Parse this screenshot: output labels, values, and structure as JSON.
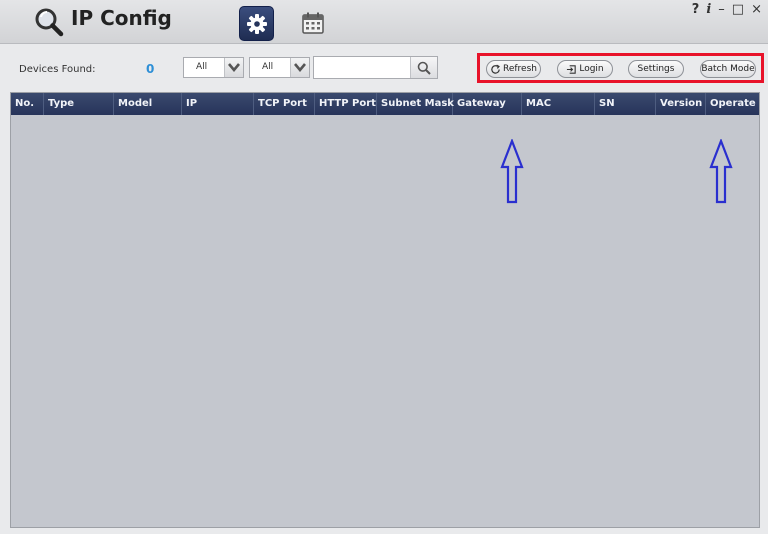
{
  "app": {
    "title": "IP Config"
  },
  "window_controls": {
    "help": "?",
    "info": "i",
    "minimize": "–",
    "maximize": "□",
    "close": "×"
  },
  "toolbar": {
    "devices_found_label": "Devices Found:",
    "devices_found_count": "0",
    "filter1": {
      "value": "All"
    },
    "filter2": {
      "value": "All"
    },
    "search": {
      "value": "",
      "placeholder": ""
    },
    "buttons": {
      "refresh": "Refresh",
      "login": "Login",
      "settings": "Settings",
      "batch_mode": "Batch Mode"
    }
  },
  "table": {
    "columns": [
      "No.",
      "Type",
      "Model",
      "IP",
      "TCP Port",
      "HTTP Port",
      "Subnet Mask",
      "Gateway",
      "MAC",
      "SN",
      "Version",
      "Operate"
    ],
    "rows": []
  },
  "colors": {
    "header_bg": "#2f3d63",
    "table_bg": "#c4c7ce",
    "accent_count": "#2e8fd6",
    "highlight_border": "#e8132a",
    "annotation_arrow": "#2a2fcf"
  },
  "icons": {
    "logo": "magnifier-icon",
    "settings_tool": "gear-icon",
    "schedule_tool": "calendar-icon",
    "search": "search-icon",
    "refresh": "refresh-icon",
    "login": "login-icon"
  }
}
